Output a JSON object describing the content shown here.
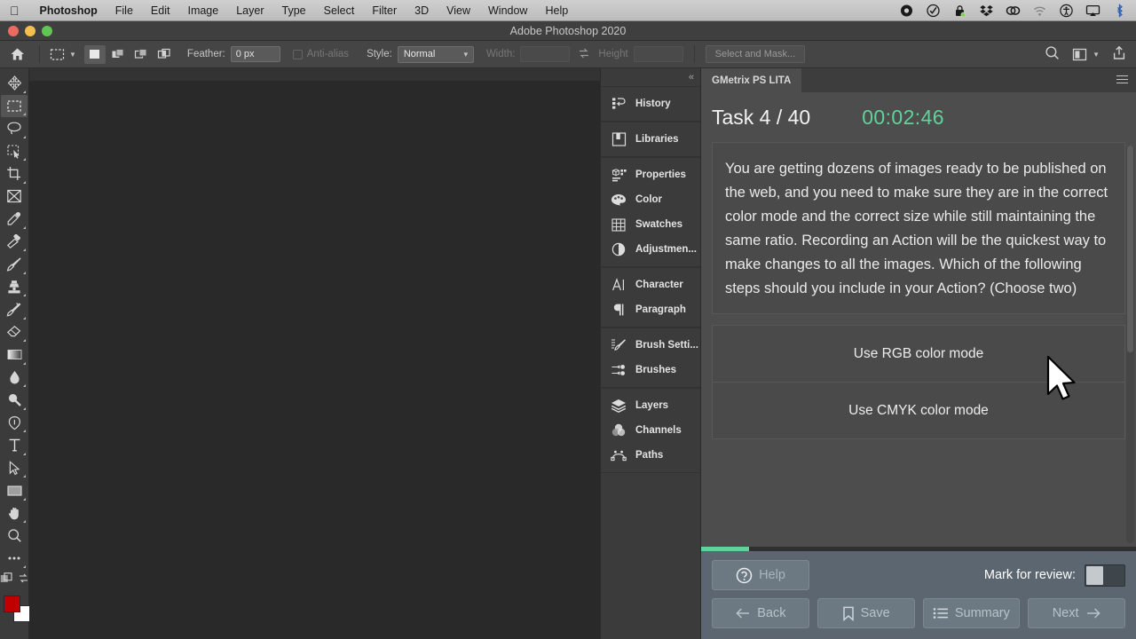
{
  "macbar": {
    "apple": "",
    "items": [
      {
        "label": "Photoshop",
        "bold": true
      },
      {
        "label": "File",
        "bold": false
      },
      {
        "label": "Edit",
        "bold": false
      },
      {
        "label": "Image",
        "bold": false
      },
      {
        "label": "Layer",
        "bold": false
      },
      {
        "label": "Type",
        "bold": false
      },
      {
        "label": "Select",
        "bold": false
      },
      {
        "label": "Filter",
        "bold": false
      },
      {
        "label": "3D",
        "bold": false
      },
      {
        "label": "View",
        "bold": false
      },
      {
        "label": "Window",
        "bold": false
      },
      {
        "label": "Help",
        "bold": false
      }
    ],
    "status_icons": [
      "record-circle-icon",
      "checkmark-circle-icon",
      "lock-icon",
      "dropbox-icon",
      "creative-cloud-icon",
      "wifi-icon",
      "accessibility-icon",
      "airplay-icon",
      "bluetooth-icon"
    ]
  },
  "titlebar": {
    "title": "Adobe Photoshop 2020"
  },
  "options_bar": {
    "home_icon": "home-icon",
    "tool_icon": "rectangular-marquee-icon",
    "tool_chevron": "chevron-down-icon",
    "mode_buttons": [
      "new-selection-icon",
      "add-to-selection-icon",
      "subtract-from-selection-icon",
      "intersect-selection-icon"
    ],
    "feather_label": "Feather:",
    "feather_value": "0 px",
    "antialias_label": "Anti-alias",
    "style_label": "Style:",
    "style_value": "Normal",
    "style_chevron": "chevron-down-icon",
    "width_label": "Width:",
    "width_value": "",
    "swap_icon": "swap-arrows-icon",
    "height_label": "Height",
    "height_value": "",
    "select_and_mask": "Select and Mask...",
    "right_icons": [
      "search-icon",
      "workspace-icon",
      "chevron-down-icon",
      "share-icon"
    ]
  },
  "toolbar": {
    "tools": [
      {
        "name": "move-tool",
        "icon": "move-icon",
        "selected": false,
        "has_flyout": true
      },
      {
        "name": "rectangular-marquee-tool",
        "icon": "marquee-icon",
        "selected": true,
        "has_flyout": true
      },
      {
        "name": "lasso-tool",
        "icon": "lasso-icon",
        "selected": false,
        "has_flyout": true
      },
      {
        "name": "quick-selection-tool",
        "icon": "quick-select-icon",
        "selected": false,
        "has_flyout": true
      },
      {
        "name": "crop-tool",
        "icon": "crop-icon",
        "selected": false,
        "has_flyout": true
      },
      {
        "name": "frame-tool",
        "icon": "frame-icon",
        "selected": false,
        "has_flyout": false
      },
      {
        "name": "eyedropper-tool",
        "icon": "eyedropper-icon",
        "selected": false,
        "has_flyout": true
      },
      {
        "name": "healing-brush-tool",
        "icon": "healing-brush-icon",
        "selected": false,
        "has_flyout": true
      },
      {
        "name": "brush-tool",
        "icon": "brush-icon",
        "selected": false,
        "has_flyout": true
      },
      {
        "name": "clone-stamp-tool",
        "icon": "clone-stamp-icon",
        "selected": false,
        "has_flyout": true
      },
      {
        "name": "history-brush-tool",
        "icon": "history-brush-icon",
        "selected": false,
        "has_flyout": true
      },
      {
        "name": "eraser-tool",
        "icon": "eraser-icon",
        "selected": false,
        "has_flyout": true
      },
      {
        "name": "gradient-tool",
        "icon": "gradient-icon",
        "selected": false,
        "has_flyout": true
      },
      {
        "name": "blur-tool",
        "icon": "blur-drop-icon",
        "selected": false,
        "has_flyout": true
      },
      {
        "name": "dodge-tool",
        "icon": "dodge-icon",
        "selected": false,
        "has_flyout": true
      },
      {
        "name": "pen-tool",
        "icon": "pen-icon",
        "selected": false,
        "has_flyout": true
      },
      {
        "name": "type-tool",
        "icon": "type-icon",
        "selected": false,
        "has_flyout": true
      },
      {
        "name": "path-selection-tool",
        "icon": "path-arrow-icon",
        "selected": false,
        "has_flyout": true
      },
      {
        "name": "rectangle-tool",
        "icon": "rectangle-icon",
        "selected": false,
        "has_flyout": true
      },
      {
        "name": "hand-tool",
        "icon": "hand-icon",
        "selected": false,
        "has_flyout": true
      },
      {
        "name": "zoom-tool",
        "icon": "zoom-magnifier-icon",
        "selected": false,
        "has_flyout": false
      },
      {
        "name": "edit-toolbar-tool",
        "icon": "ellipsis-icon",
        "selected": false,
        "has_flyout": false
      }
    ],
    "quick_mask_icon": "quick-mask-icon",
    "swap_colors_icon": "swap-colors-icon",
    "foreground_color": "#c00000",
    "background_color": "#ffffff"
  },
  "dock": {
    "collapse_icon": "double-chevron-left-icon",
    "groups": [
      {
        "items": [
          {
            "label": "History",
            "icon": "history-icon"
          }
        ]
      },
      {
        "items": [
          {
            "label": "Libraries",
            "icon": "libraries-icon"
          }
        ]
      },
      {
        "items": [
          {
            "label": "Properties",
            "icon": "properties-icon"
          },
          {
            "label": "Color",
            "icon": "color-palette-icon"
          },
          {
            "label": "Swatches",
            "icon": "swatches-grid-icon"
          },
          {
            "label": "Adjustmen...",
            "icon": "adjustments-icon"
          }
        ]
      },
      {
        "items": [
          {
            "label": "Character",
            "icon": "character-icon"
          },
          {
            "label": "Paragraph",
            "icon": "paragraph-icon"
          }
        ]
      },
      {
        "items": [
          {
            "label": "Brush Setti...",
            "icon": "brush-settings-icon"
          },
          {
            "label": "Brushes",
            "icon": "brushes-icon"
          }
        ]
      },
      {
        "items": [
          {
            "label": "Layers",
            "icon": "layers-icon"
          },
          {
            "label": "Channels",
            "icon": "channels-icon"
          },
          {
            "label": "Paths",
            "icon": "paths-icon"
          }
        ]
      }
    ]
  },
  "gmetrix": {
    "expand_icon": "double-chevron-right-icon",
    "tab_label": "GMetrix PS LITA",
    "panel_menu_icon": "hamburger-menu-icon",
    "task_label": "Task 4 / 40",
    "timer": "00:02:46",
    "timer_color": "#5fd39a",
    "question": "You are getting dozens of images ready to be published on the web, and you need to make sure they are in the correct color mode and the correct size while still maintaining the same ratio. Recording an Action will be the quickest way to make changes to all the images. Which of the following steps should you include in your Action? (Choose two)",
    "options": [
      {
        "label": "Use RGB color mode",
        "selected": false
      },
      {
        "label": "Use CMYK color mode",
        "selected": false
      }
    ],
    "progress_percent": 11,
    "progress_color": "#5fd39a",
    "footer": {
      "help_label": "Help",
      "help_icon": "question-circle-icon",
      "mark_label": "Mark for review:",
      "mark_toggle_state": "off",
      "back_label": "Back",
      "back_icon": "arrow-left-icon",
      "save_label": "Save",
      "save_icon": "bookmark-icon",
      "summary_label": "Summary",
      "summary_icon": "list-icon",
      "next_label": "Next",
      "next_icon": "arrow-right-icon"
    }
  },
  "cursor": {
    "icon": "mouse-pointer-icon"
  }
}
